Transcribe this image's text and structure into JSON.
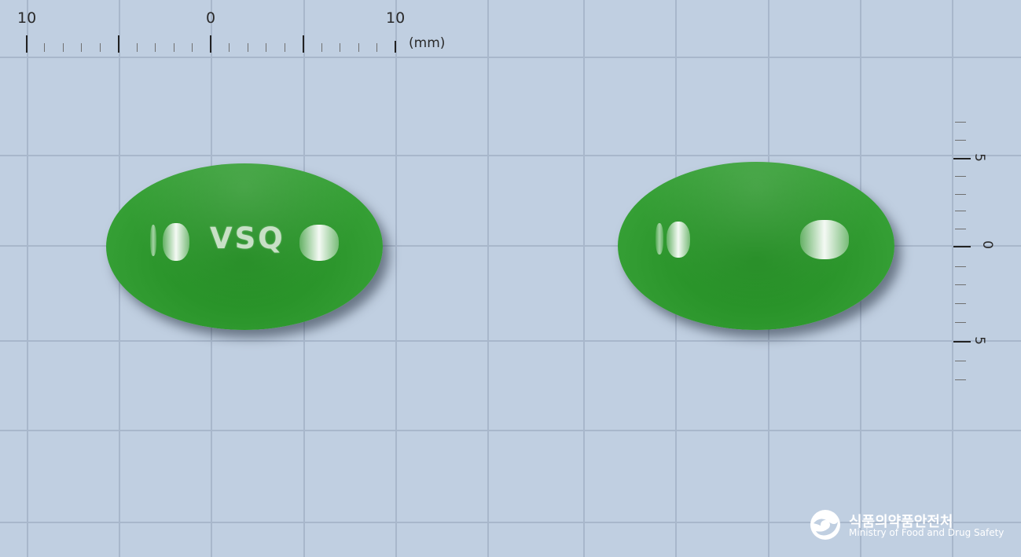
{
  "ruler_top": {
    "labels": [
      "10",
      "0",
      "10"
    ],
    "unit": "(mm)"
  },
  "ruler_right": {
    "labels": [
      "5",
      "0",
      "5"
    ]
  },
  "pills": [
    {
      "side": "front",
      "imprint": "VSQ",
      "color": "#2c962c"
    },
    {
      "side": "back",
      "imprint": "",
      "color": "#2c962c"
    }
  ],
  "watermark": {
    "name_korean": "식품의약품안전처",
    "name_english": "Ministry of Food and Drug Safety"
  }
}
